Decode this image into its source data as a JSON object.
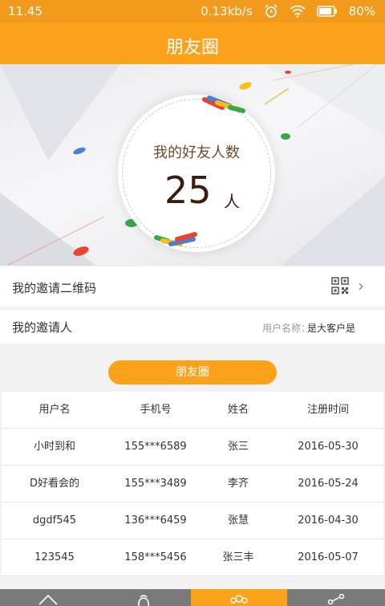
{
  "status_bar": {
    "time": "11.45",
    "network_speed": "0.13kb/s",
    "battery": "80%"
  },
  "header": {
    "title": "朋友圈"
  },
  "hero": {
    "label": "我的好友人数",
    "count": "25",
    "unit": "人"
  },
  "menu": {
    "qr_label": "我的邀请二维码",
    "inviter_label": "我的邀请人",
    "inviter_key": "用户名称：",
    "inviter_value": "是大客户是"
  },
  "section_button": "朋友圈",
  "table": {
    "headers": [
      "用户名",
      "手机号",
      "姓名",
      "注册时间"
    ],
    "rows": [
      [
        "小时到和",
        "155***6589",
        "张三",
        "2016-05-30"
      ],
      [
        "D好看会的",
        "155***3489",
        "李齐",
        "2016-05-24"
      ],
      [
        "dgdf545",
        "136***6459",
        "张慧",
        "2016-04-30"
      ],
      [
        "123545",
        "158***5456",
        "张三丰",
        "2016-05-07"
      ]
    ]
  },
  "tabbar": {
    "icons": [
      "home-icon",
      "money-bag-icon",
      "friends-icon",
      "share-icon"
    ],
    "active_index": 2
  },
  "colors": {
    "brand": "#fba21a",
    "statusbar": "#f29a1c",
    "tabbar": "#7a7a7a"
  }
}
